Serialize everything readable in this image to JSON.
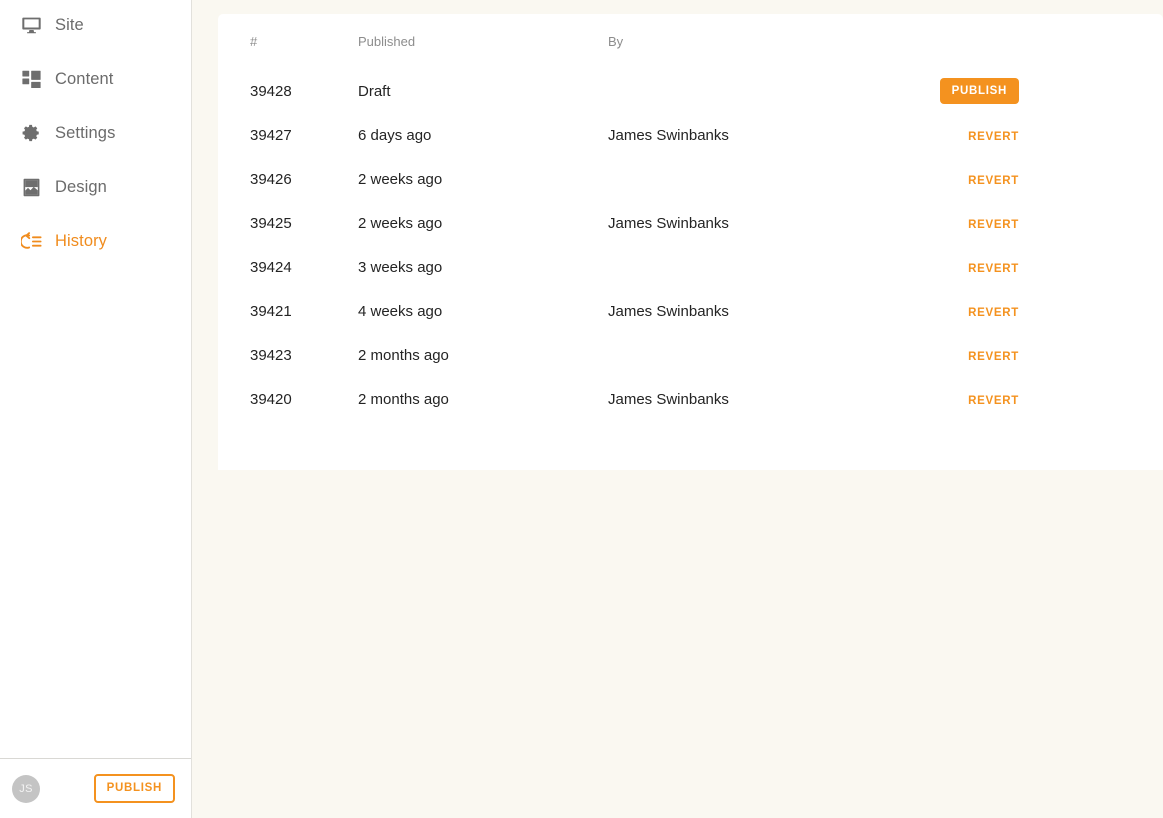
{
  "theme": {
    "accent": "#f4921f",
    "page_background": "#faf8f1",
    "card_background": "#ffffff",
    "sidebar_background": "#ffffff",
    "text_primary": "#242424",
    "text_muted": "#8d8d8d",
    "nav_text": "#6b6b6b"
  },
  "sidebar": {
    "items": [
      {
        "label": "Site",
        "icon": "monitor-icon",
        "active": false
      },
      {
        "label": "Content",
        "icon": "grid-icon",
        "active": false
      },
      {
        "label": "Settings",
        "icon": "gear-icon",
        "active": false
      },
      {
        "label": "Design",
        "icon": "image-icon",
        "active": false
      },
      {
        "label": "History",
        "icon": "history-icon",
        "active": true
      }
    ],
    "footer": {
      "avatar_initials": "JS",
      "publish_label": "PUBLISH"
    }
  },
  "main": {
    "table": {
      "columns": [
        {
          "key": "number",
          "label": "#"
        },
        {
          "key": "published",
          "label": "Published"
        },
        {
          "key": "by",
          "label": "By"
        },
        {
          "key": "action",
          "label": ""
        }
      ],
      "rows": [
        {
          "number": "39428",
          "published": "Draft",
          "by": "",
          "action_label": "PUBLISH",
          "action_type": "button"
        },
        {
          "number": "39427",
          "published": "6 days ago",
          "by": "James Swinbanks",
          "action_label": "REVERT",
          "action_type": "link"
        },
        {
          "number": "39426",
          "published": "2 weeks ago",
          "by": "",
          "action_label": "REVERT",
          "action_type": "link"
        },
        {
          "number": "39425",
          "published": "2 weeks ago",
          "by": "James Swinbanks",
          "action_label": "REVERT",
          "action_type": "link"
        },
        {
          "number": "39424",
          "published": "3 weeks ago",
          "by": "",
          "action_label": "REVERT",
          "action_type": "link"
        },
        {
          "number": "39421",
          "published": "4 weeks ago",
          "by": "James Swinbanks",
          "action_label": "REVERT",
          "action_type": "link"
        },
        {
          "number": "39423",
          "published": "2 months ago",
          "by": "",
          "action_label": "REVERT",
          "action_type": "link"
        },
        {
          "number": "39420",
          "published": "2 months ago",
          "by": "James Swinbanks",
          "action_label": "REVERT",
          "action_type": "link"
        }
      ]
    }
  }
}
